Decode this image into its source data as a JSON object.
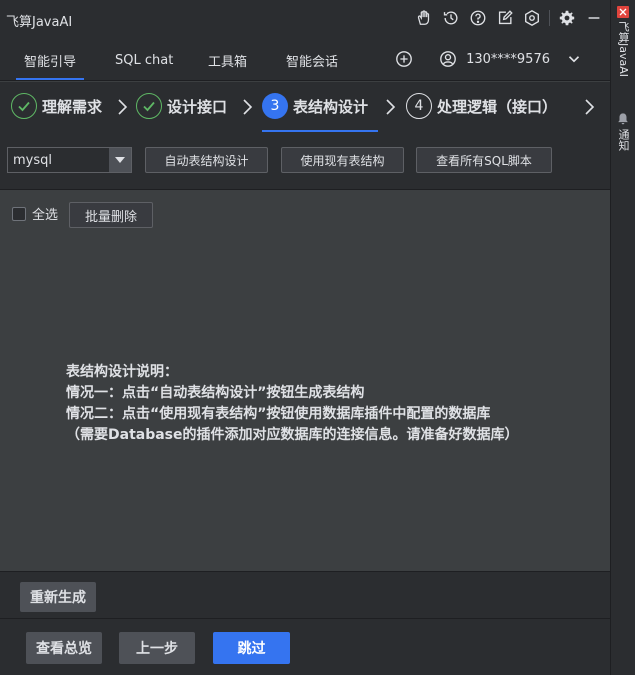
{
  "window": {
    "title": "飞算JavaAI"
  },
  "nav": {
    "tabs": [
      {
        "label": "智能引导"
      },
      {
        "label": "SQL chat"
      },
      {
        "label": "工具箱"
      },
      {
        "label": "智能会话"
      }
    ],
    "user": "130****9576"
  },
  "steps": [
    {
      "number": "",
      "label": "理解需求",
      "state": "done"
    },
    {
      "number": "",
      "label": "设计接口",
      "state": "done"
    },
    {
      "number": "3",
      "label": "表结构设计",
      "state": "current"
    },
    {
      "number": "4",
      "label": "处理逻辑（接口）",
      "state": "todo"
    }
  ],
  "toolbar": {
    "db_select": "mysql",
    "auto_design": "自动表结构设计",
    "use_existing": "使用现有表结构",
    "view_sql": "查看所有SQL脚本"
  },
  "list": {
    "select_all": "全选",
    "batch_delete": "批量删除"
  },
  "description": {
    "title": "表结构设计说明：",
    "line1": "情况一：点击“自动表结构设计”按钮生成表结构",
    "line2": "情况二：点击“使用现有表结构”按钮使用数据库插件中配置的数据库",
    "line3": "（需要Database的插件添加对应数据库的连接信息。请准备好数据库）"
  },
  "actions": {
    "regenerate": "重新生成",
    "overview": "查看总览",
    "prev": "上一步",
    "skip": "跳过"
  },
  "right_strip": {
    "plugin_tab": "飞算JavaAI",
    "notify_tab": "通知"
  },
  "colors": {
    "accent": "#3574f0",
    "done": "#5fb865",
    "brand": "#e0443d"
  }
}
